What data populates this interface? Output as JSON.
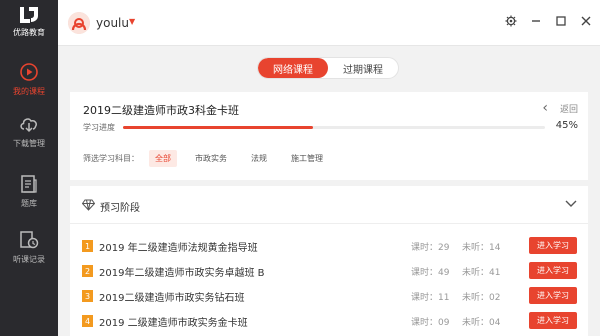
{
  "brand": {
    "logo_text": "优路教育"
  },
  "sidebar": {
    "items": [
      {
        "label": "我的课程",
        "icon": "play-circle-icon",
        "active": true
      },
      {
        "label": "下载管理",
        "icon": "cloud-download-icon",
        "active": false
      },
      {
        "label": "题库",
        "icon": "question-bank-icon",
        "active": false
      },
      {
        "label": "听课记录",
        "icon": "history-record-icon",
        "active": false
      }
    ]
  },
  "header": {
    "username": "youlu",
    "window_controls": [
      "settings-icon",
      "minimize-icon",
      "maximize-icon",
      "close-icon"
    ]
  },
  "tabs": [
    {
      "label": "网络课程",
      "active": true
    },
    {
      "label": "过期课程",
      "active": false
    }
  ],
  "course": {
    "title": "2019二级建造师市政3科金卡班",
    "back_label": "返回",
    "progress_label": "学习进度",
    "progress_percent": 45,
    "progress_text": "45%",
    "filter_label": "筛选学习科目：",
    "filters": [
      {
        "label": "全部",
        "active": true
      },
      {
        "label": "市政实务",
        "active": false
      },
      {
        "label": "法规",
        "active": false
      },
      {
        "label": "施工管理",
        "active": false
      }
    ]
  },
  "phase": {
    "title": "预习阶段",
    "lessons": [
      {
        "num": "1",
        "name": "2019 年二级建造师法规黄金指导班",
        "hours": "课时：29",
        "unheard": "未听：14",
        "button": "进入学习"
      },
      {
        "num": "2",
        "name": "2019年二级建造师市政实务卓越班 B",
        "hours": "课时：49",
        "unheard": "未听：41",
        "button": "进入学习"
      },
      {
        "num": "3",
        "name": "2019二级建造师市政实务钻石班",
        "hours": "课时：11",
        "unheard": "未听：02",
        "button": "进入学习"
      },
      {
        "num": "4",
        "name": "2019 二级建造师市政实务金卡班",
        "hours": "课时：09",
        "unheard": "未听：04",
        "button": "进入学习"
      }
    ]
  },
  "colors": {
    "accent": "#e8442f",
    "sidebar_bg": "#2a2a2e",
    "badge": "#f39a1f"
  }
}
